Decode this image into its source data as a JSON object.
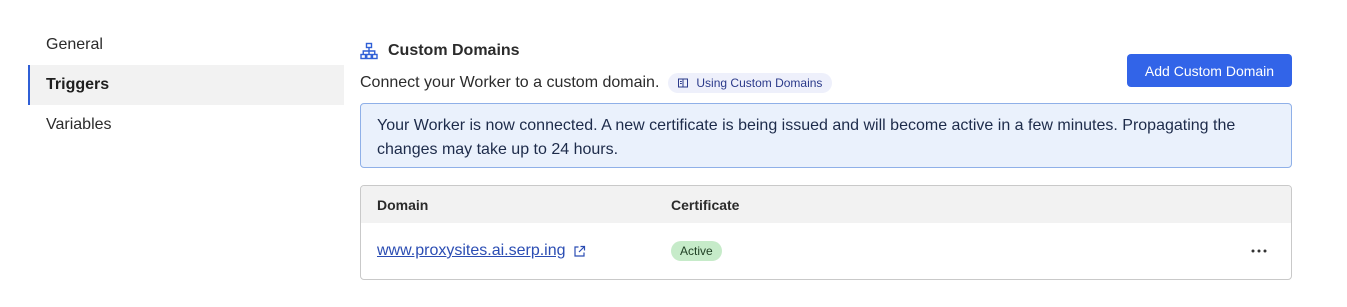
{
  "sidebar": {
    "items": [
      {
        "label": "General",
        "active": false
      },
      {
        "label": "Triggers",
        "active": true
      },
      {
        "label": "Variables",
        "active": false
      }
    ]
  },
  "section": {
    "icon": "sitemap-icon",
    "title": "Custom Domains",
    "description": "Connect your Worker to a custom domain.",
    "doc_link": {
      "icon": "book-icon",
      "label": "Using Custom Domains"
    },
    "add_button": "Add Custom Domain"
  },
  "notice": {
    "text": "Your Worker is now connected. A new certificate is being issued and will become active in a few minutes. Propagating the changes may take up to 24 hours."
  },
  "table": {
    "columns": [
      "Domain",
      "Certificate"
    ],
    "rows": [
      {
        "domain": "www.proxysites.ai.serp.ing",
        "certificate": "Active",
        "link_icon": "external-link-icon",
        "menu_icon": "more-horizontal-icon"
      }
    ]
  },
  "colors": {
    "accent": "#3264e8",
    "notice_bg": "#eaf1fc",
    "badge_bg": "#c6ebc9",
    "active_border": "#2f5fd6"
  }
}
